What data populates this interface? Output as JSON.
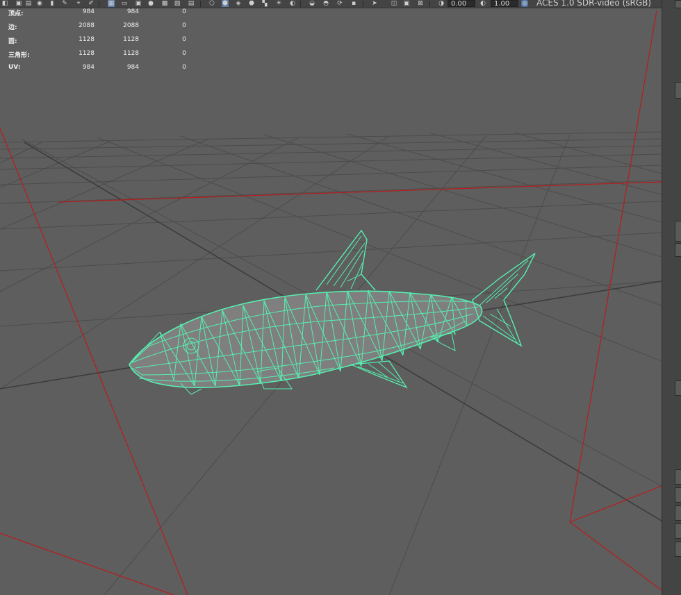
{
  "toolbar": {
    "exposure_value": "0.00",
    "gamma_value": "1.00",
    "color_space": "ACES 1.0 SDR-video (sRGB)",
    "icons": [
      "camera-icon",
      "lock-icon",
      "bookmark-icon",
      "snapshot-icon",
      "grid-icon",
      "film-gate-icon",
      "resolution-gate-icon",
      "safe-action-icon",
      "field-chart-icon",
      "wireframe-icon",
      "smooth-shade-icon",
      "textured-icon",
      "lights-icon",
      "shadows-icon",
      "ambient-occlusion-icon",
      "isolate-select-icon",
      "xray-icon",
      "exposure-icon",
      "gamma-icon",
      "color-management-icon"
    ]
  },
  "hud": {
    "rows": [
      {
        "label": "顶点:",
        "v1": "984",
        "v2": "984",
        "v3": "0"
      },
      {
        "label": "边:",
        "v1": "2088",
        "v2": "2088",
        "v3": "0"
      },
      {
        "label": "面:",
        "v1": "1128",
        "v2": "1128",
        "v3": "0"
      },
      {
        "label": "三角形:",
        "v1": "1128",
        "v2": "1128",
        "v3": "0"
      },
      {
        "label": "UV:",
        "v1": "984",
        "v2": "984",
        "v3": "0"
      }
    ]
  },
  "viewport": {
    "background": "#5e5e5e",
    "grid_color": "#4a4a4a",
    "axis_color": "#3a3a3a",
    "frustum_color": "#c02020",
    "wire_color": "#55f0b0",
    "body_shade": "#8a8a8a",
    "object": "shark-wireframe"
  }
}
